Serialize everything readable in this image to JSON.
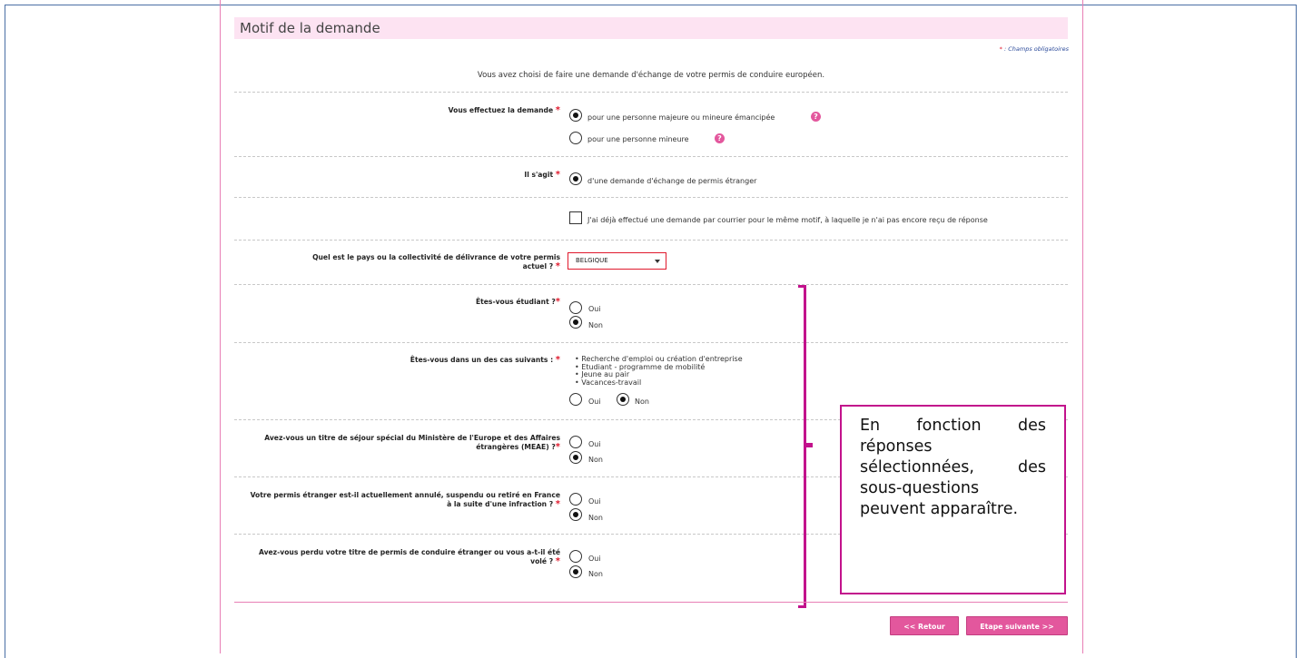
{
  "section": {
    "title": "Motif de la demande",
    "legend_star": "*",
    "legend_text": " : Champs obligatoires",
    "intro": "Vous avez choisi de faire une demande d'échange de votre permis de conduire européen."
  },
  "q_demande": {
    "label": "Vous effectuez la demande",
    "star": "*",
    "opt1": "pour une personne majeure ou mineure émancipée",
    "opt2": "pour une personne mineure",
    "help": "?"
  },
  "q_agit": {
    "label": "Il s'agit",
    "star": "*",
    "opt1": "d'une demande d'échange de permis étranger"
  },
  "courrier": {
    "label": "J'ai déjà effectué une demande par courrier pour le même motif, à laquelle je n'ai pas encore reçu de réponse"
  },
  "q_pays": {
    "label_line1": "Quel est le pays ou la collectivité de délivrance de votre permis",
    "label_line2": "actuel ?",
    "star": "*",
    "value": "BELGIQUE"
  },
  "q_etudiant": {
    "label": "Êtes-vous étudiant ?",
    "star": "*",
    "oui": "Oui",
    "non": "Non"
  },
  "q_cas": {
    "label": "Êtes-vous dans un des cas suivants :",
    "star": "*",
    "items": [
      "Recherche d'emploi ou création d'entreprise",
      "Etudiant - programme de mobilité",
      "Jeune au pair",
      "Vacances-travail"
    ],
    "oui": "Oui",
    "non": "Non"
  },
  "q_meae": {
    "label_line1": "Avez-vous un titre de séjour spécial du Ministère de l'Europe et des Affaires",
    "label_line2": "étrangères (MEAE) ?",
    "star": "*",
    "oui": "Oui",
    "non": "Non"
  },
  "q_annule": {
    "label_line1": "Votre permis étranger est-il actuellement annulé, suspendu ou retiré en France",
    "label_line2": "à la suite d'une infraction ?",
    "star": "*",
    "oui": "Oui",
    "non": "Non"
  },
  "q_perdu": {
    "label_line1": "Avez-vous perdu votre titre de permis de conduire étranger ou vous a-t-il été",
    "label_line2": "volé ?",
    "star": "*",
    "oui": "Oui",
    "non": "Non"
  },
  "callout": {
    "text": "En fonction des réponses sélectionnées, des sous-questions peuvent apparaître."
  },
  "buttons": {
    "back": "<< Retour",
    "next": "Etape suivante >>"
  },
  "colors": {
    "accent": "#e3579d",
    "annotation": "#c2128c",
    "header_bg": "#fde3f2",
    "required": "#e0192c"
  }
}
